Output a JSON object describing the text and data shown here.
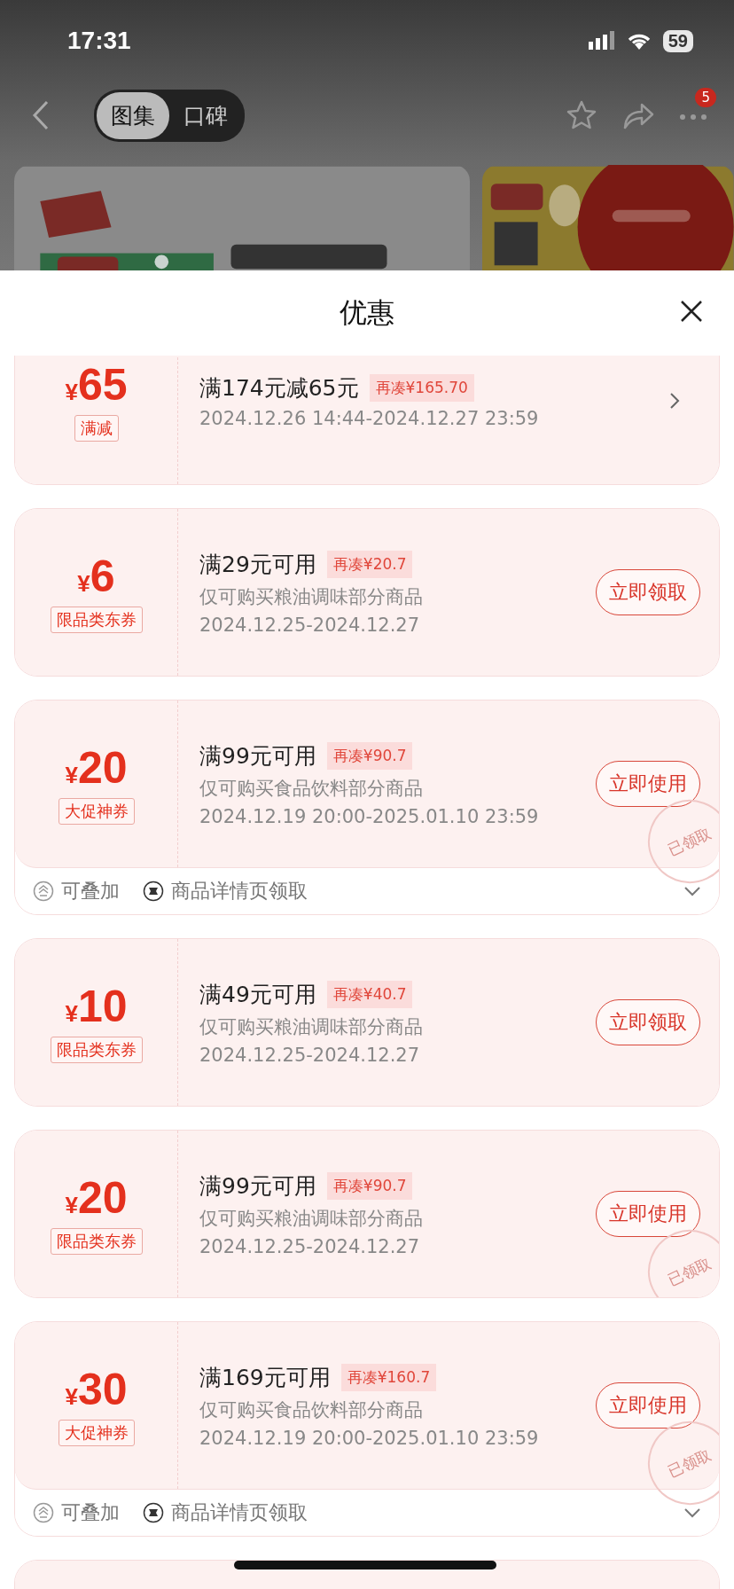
{
  "status_bar": {
    "time": "17:31",
    "battery": "59"
  },
  "nav": {
    "tabs": [
      {
        "label": "图集",
        "selected": true
      },
      {
        "label": "口碑",
        "selected": false
      }
    ],
    "badge": "5"
  },
  "sheet": {
    "title": "优惠"
  },
  "coupons": [
    {
      "currency": "¥",
      "amount": "65",
      "tag": "满减",
      "title": "满174元减65元",
      "gap": "再凑¥165.70",
      "dates": "2024.12.26 14:44-2024.12.27 23:59",
      "action": {
        "kind": "chevron"
      },
      "clipped": true
    },
    {
      "currency": "¥",
      "amount": "6",
      "tag": "限品类东券",
      "title": "满29元可用",
      "gap": "再凑¥20.7",
      "scope": "仅可购买粮油调味部分商品",
      "dates": "2024.12.25-2024.12.27",
      "action": {
        "kind": "button",
        "label": "立即领取"
      }
    },
    {
      "currency": "¥",
      "amount": "20",
      "tag": "大促神券",
      "title": "满99元可用",
      "gap": "再凑¥90.7",
      "scope": "仅可购买食品饮料部分商品",
      "dates": "2024.12.19 20:00-2025.01.10 23:59",
      "action": {
        "kind": "button",
        "label": "立即使用"
      },
      "stamp": "已领取",
      "footer": {
        "stackable": "可叠加",
        "source": "商品详情页领取"
      }
    },
    {
      "currency": "¥",
      "amount": "10",
      "tag": "限品类东券",
      "title": "满49元可用",
      "gap": "再凑¥40.7",
      "scope": "仅可购买粮油调味部分商品",
      "dates": "2024.12.25-2024.12.27",
      "action": {
        "kind": "button",
        "label": "立即领取"
      }
    },
    {
      "currency": "¥",
      "amount": "20",
      "tag": "限品类东券",
      "title": "满99元可用",
      "gap": "再凑¥90.7",
      "scope": "仅可购买粮油调味部分商品",
      "dates": "2024.12.25-2024.12.27",
      "action": {
        "kind": "button",
        "label": "立即使用"
      },
      "stamp": "已领取"
    },
    {
      "currency": "¥",
      "amount": "30",
      "tag": "大促神券",
      "title": "满169元可用",
      "gap": "再凑¥160.7",
      "scope": "仅可购买食品饮料部分商品",
      "dates": "2024.12.19 20:00-2025.01.10 23:59",
      "action": {
        "kind": "button",
        "label": "立即使用"
      },
      "stamp": "已领取",
      "footer": {
        "stackable": "可叠加",
        "source": "商品详情页领取"
      }
    },
    {
      "kind": "stub"
    }
  ]
}
